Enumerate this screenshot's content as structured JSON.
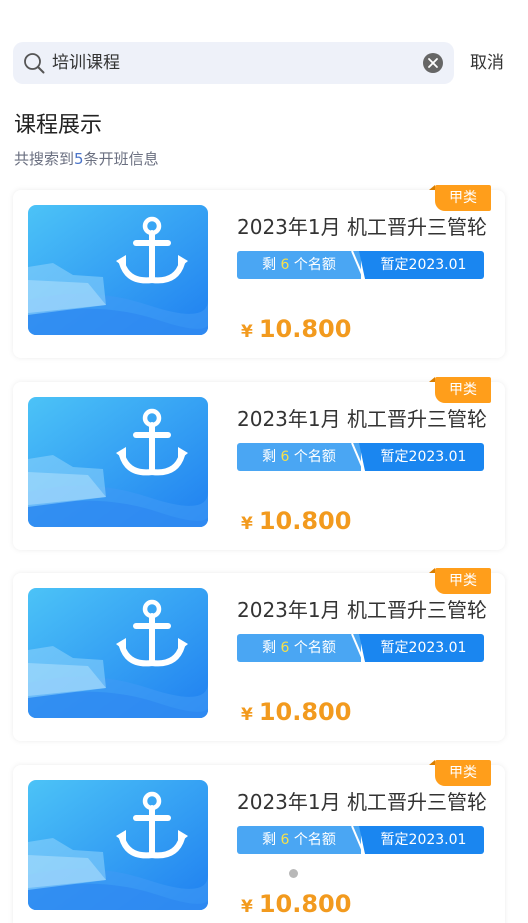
{
  "search": {
    "query": "培训课程",
    "cancel_label": "取消"
  },
  "section": {
    "title": "课程展示",
    "result_prefix": "共搜索到",
    "result_count": "5",
    "result_suffix": "条开班信息"
  },
  "courses": [
    {
      "badge": "甲类",
      "title": "2023年1月  机工晋升三管轮",
      "remain_prefix": "剩",
      "remain_count": "6",
      "remain_suffix": "个名额",
      "date_label": "暂定2023.01",
      "currency": "¥",
      "price": "10.800"
    },
    {
      "badge": "甲类",
      "title": "2023年1月  机工晋升三管轮",
      "remain_prefix": "剩",
      "remain_count": "6",
      "remain_suffix": "个名额",
      "date_label": "暂定2023.01",
      "currency": "¥",
      "price": "10.800"
    },
    {
      "badge": "甲类",
      "title": "2023年1月  机工晋升三管轮",
      "remain_prefix": "剩",
      "remain_count": "6",
      "remain_suffix": "个名额",
      "date_label": "暂定2023.01",
      "currency": "¥",
      "price": "10.800"
    },
    {
      "badge": "甲类",
      "title": "2023年1月  机工晋升三管轮",
      "remain_prefix": "剩",
      "remain_count": "6",
      "remain_suffix": "个名额",
      "date_label": "暂定2023.01",
      "currency": "¥",
      "price": "10.800"
    }
  ],
  "colors": {
    "accent_orange": "#ff9e1b",
    "price_orange": "#f29a1e",
    "tag_light_blue": "#4aa6f3",
    "tag_blue": "#1a86f0"
  },
  "icons": {
    "search": "search-icon",
    "clear": "clear-icon",
    "thumbnail": "anchor-icon"
  }
}
